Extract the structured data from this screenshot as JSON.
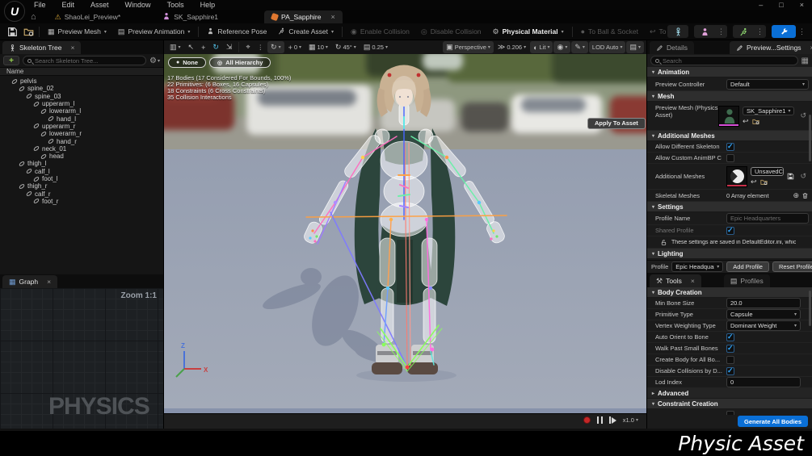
{
  "window": {
    "menus": [
      "File",
      "Edit",
      "Asset",
      "Window",
      "Tools",
      "Help"
    ],
    "controls": {
      "minimize": "–",
      "maximize": "□",
      "close": "×"
    },
    "logo": "U"
  },
  "asset_tabs": [
    {
      "label": "ShaoLei_Preview*"
    },
    {
      "label": "SK_Sapphire1"
    },
    {
      "label": "PA_Sapphire",
      "active": true
    }
  ],
  "main_toolbar": {
    "buttons": [
      {
        "label": "Preview Mesh",
        "enabled": true
      },
      {
        "label": "Preview Animation",
        "enabled": true
      },
      {
        "label": "Reference Pose",
        "enabled": true
      },
      {
        "label": "Create Asset",
        "enabled": true
      },
      {
        "label": "Enable Collision",
        "enabled": false
      },
      {
        "label": "Disable Collision",
        "enabled": false
      },
      {
        "label": "Physical Material",
        "enabled": true
      },
      {
        "label": "To Ball & Socket",
        "enabled": false
      },
      {
        "label": "To Hinge",
        "enabled": false
      }
    ]
  },
  "skeleton_tree": {
    "tab": "Skeleton Tree",
    "search_placeholder": "Search Skeleton Tree...",
    "name_header": "Name",
    "items": [
      {
        "label": "pelvis",
        "level": 0
      },
      {
        "label": "spine_02",
        "level": 1
      },
      {
        "label": "spine_03",
        "level": 2
      },
      {
        "label": "upperarm_l",
        "level": 3
      },
      {
        "label": "lowerarm_l",
        "level": 4
      },
      {
        "label": "hand_l",
        "level": 5
      },
      {
        "label": "upperarm_r",
        "level": 3
      },
      {
        "label": "lowerarm_r",
        "level": 4
      },
      {
        "label": "hand_r",
        "level": 5
      },
      {
        "label": "neck_01",
        "level": 3
      },
      {
        "label": "head",
        "level": 4
      },
      {
        "label": "thigh_l",
        "level": 1
      },
      {
        "label": "calf_l",
        "level": 2
      },
      {
        "label": "foot_l",
        "level": 3
      },
      {
        "label": "thigh_r",
        "level": 1
      },
      {
        "label": "calf_r",
        "level": 2
      },
      {
        "label": "foot_r",
        "level": 3
      }
    ]
  },
  "graph": {
    "tab": "Graph",
    "zoom_label": "Zoom 1:1",
    "watermark": "PHYSICS"
  },
  "viewport": {
    "perspective": "Perspective",
    "camera_speed": "0.206",
    "lit": "Lit",
    "lod": "LOD Auto",
    "snap_values": {
      "surface": "0",
      "grid": "10",
      "rotation": "45°",
      "scale": "0.25"
    },
    "filters": {
      "none": "None",
      "all_hierarchy": "All Hierarchy"
    },
    "stats": [
      "17 Bodies (17 Considered For Bounds, 100%)",
      "22 Primitives: (6 Boxes, 16 Capsules)",
      "18 Constraints (6 Cross Constraints)",
      "35 Collision Interactions"
    ],
    "playback_speed": "x1.0",
    "axis": {
      "x": "X",
      "z": "Z"
    }
  },
  "details": {
    "tabs": {
      "details": "Details",
      "preview_settings": "Preview...Settings"
    },
    "search_placeholder": "Search",
    "sections": {
      "animation": "Animation",
      "mesh": "Mesh",
      "additional_meshes": "Additional Meshes",
      "settings": "Settings",
      "lighting": "Lighting"
    },
    "preview_controller": {
      "label": "Preview Controller",
      "value": "Default"
    },
    "preview_mesh": {
      "label": "Preview Mesh (Physics Asset)",
      "value": "SK_Sapphire1",
      "apply": "Apply To Asset"
    },
    "allow_different_skeleton": {
      "label": "Allow Different Skeleton",
      "checked": true
    },
    "allow_custom_animbp": {
      "label": "Allow Custom AnimBP C",
      "checked": false
    },
    "additional_meshes_row": {
      "label": "Additional Meshes",
      "value": "UnsavedCol"
    },
    "skeletal_meshes": {
      "label": "Skeletal Meshes",
      "value": "0 Array element"
    },
    "profile_name": {
      "label": "Profile Name",
      "placeholder": "Epic Headquarters"
    },
    "shared_profile": {
      "label": "Shared Profile",
      "checked": true
    },
    "settings_note": "These settings are saved in DefaultEditor.ini, whic",
    "profile_bar": {
      "label": "Profile",
      "value": "Epic Headquarters",
      "add": "Add Profile",
      "reset": "Reset Profile"
    }
  },
  "tools": {
    "tabs": {
      "tools": "Tools",
      "profiles": "Profiles"
    },
    "section_body_creation": "Body Creation",
    "rows": [
      {
        "label": "Min Bone Size",
        "type": "input",
        "value": "20.0"
      },
      {
        "label": "Primitive Type",
        "type": "select",
        "value": "Capsule"
      },
      {
        "label": "Vertex Weighting Type",
        "type": "select",
        "value": "Dominant Weight"
      },
      {
        "label": "Auto Orient to Bone",
        "type": "check",
        "checked": true
      },
      {
        "label": "Walk Past Small Bones",
        "type": "check",
        "checked": true
      },
      {
        "label": "Create Body for All Bo...",
        "type": "check",
        "checked": false
      },
      {
        "label": "Disable Collisions by D...",
        "type": "check",
        "checked": true
      },
      {
        "label": "Lod Index",
        "type": "input",
        "value": "0"
      }
    ],
    "section_advanced": "Advanced",
    "section_constraint_creation": "Constraint Creation",
    "generate_button": "Generate All Bodies"
  },
  "footer": {
    "caption": "Physic Asset"
  },
  "icons": {
    "home": "⌂",
    "warning": "⚠",
    "close": "×",
    "chevron": "▾",
    "kebab": "⋮",
    "hamburger": "≡",
    "gear": "⚙",
    "plus": "+",
    "reset": "↺",
    "add_circle": "⊕",
    "select": "↖",
    "move": "+",
    "rotate": "↻",
    "scale": "⇲",
    "snap_target": "⌖",
    "camera": "▥",
    "perspective": "▣",
    "lit": "◐",
    "visibility": "◉",
    "paint": "✎",
    "screenshot": "▤",
    "grid": "▦",
    "radio_on": "●",
    "radio_ring": "◎",
    "use_arrow": "↩",
    "speed": "≫",
    "hammer": "⚒",
    "pencil": "✎",
    "graph": "▦"
  },
  "colors": {
    "accent_blue": "#0a6fd6",
    "check_blue": "#2fa8ff",
    "record_red": "#c42727",
    "floor": "#98a1b2",
    "physics_asset_orange": "#e07830",
    "cape_green": "#2c453c"
  }
}
